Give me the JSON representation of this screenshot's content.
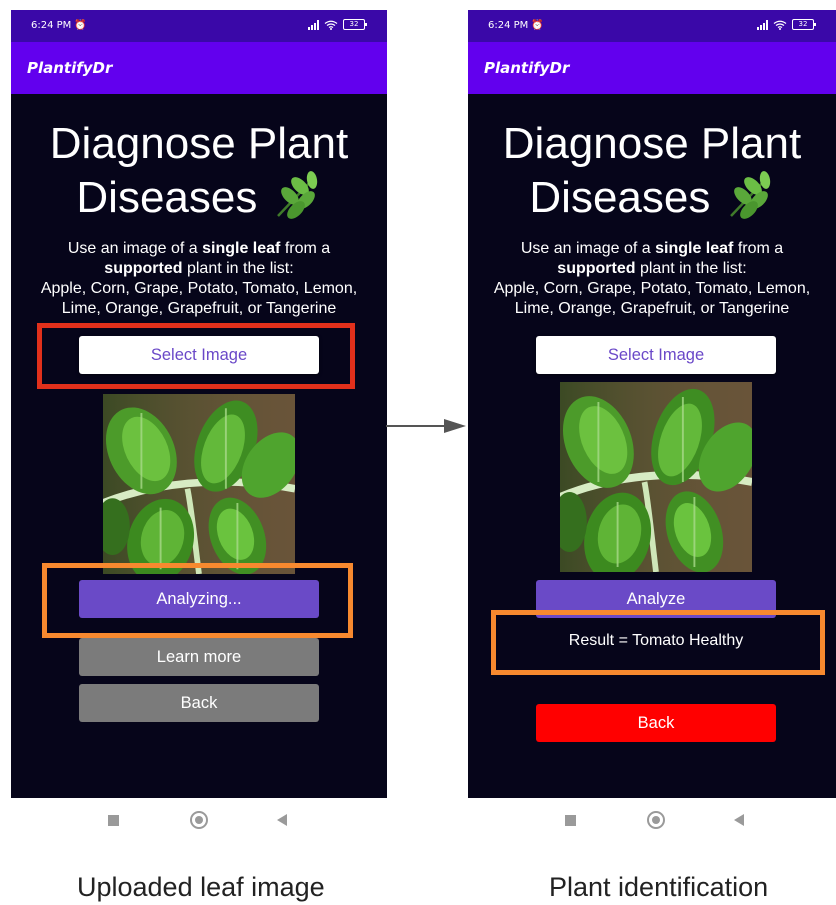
{
  "status_bar": {
    "time": "6:24 PM",
    "battery": "32"
  },
  "app": {
    "title": "PlantifyDr"
  },
  "screen": {
    "heading_line1": "Diagnose Plant",
    "heading_line2": "Diseases",
    "heading_icon": "herb-leaf-emoji",
    "desc_part1": "Use an image of a ",
    "desc_bold1": "single leaf",
    "desc_part2": " from a",
    "desc_bold2": "supported",
    "desc_part3": " plant in the list:",
    "desc_line3": "Apple, Corn, Grape, Potato, Tomato, Lemon,",
    "desc_line4": "Lime, Orange, Grapefruit, or Tangerine",
    "select_image_label": "Select Image"
  },
  "left_screen": {
    "analyze_label": "Analyzing...",
    "learn_more_label": "Learn more",
    "back_label": "Back"
  },
  "right_screen": {
    "analyze_label": "Analyze",
    "result_text": "Result = Tomato Healthy",
    "back_label": "Back"
  },
  "captions": {
    "left": "Uploaded leaf image",
    "right": "Plant identification"
  },
  "colors": {
    "status_bar": "#3a08a8",
    "app_bar": "#6200ee",
    "screen_bg": "#06051a",
    "analyze_button": "#6a4ac7",
    "grey_button": "#7b7b7b",
    "back_button_right": "#ff0000",
    "highlight_red": "#e1301b",
    "highlight_orange": "#f7892f"
  }
}
